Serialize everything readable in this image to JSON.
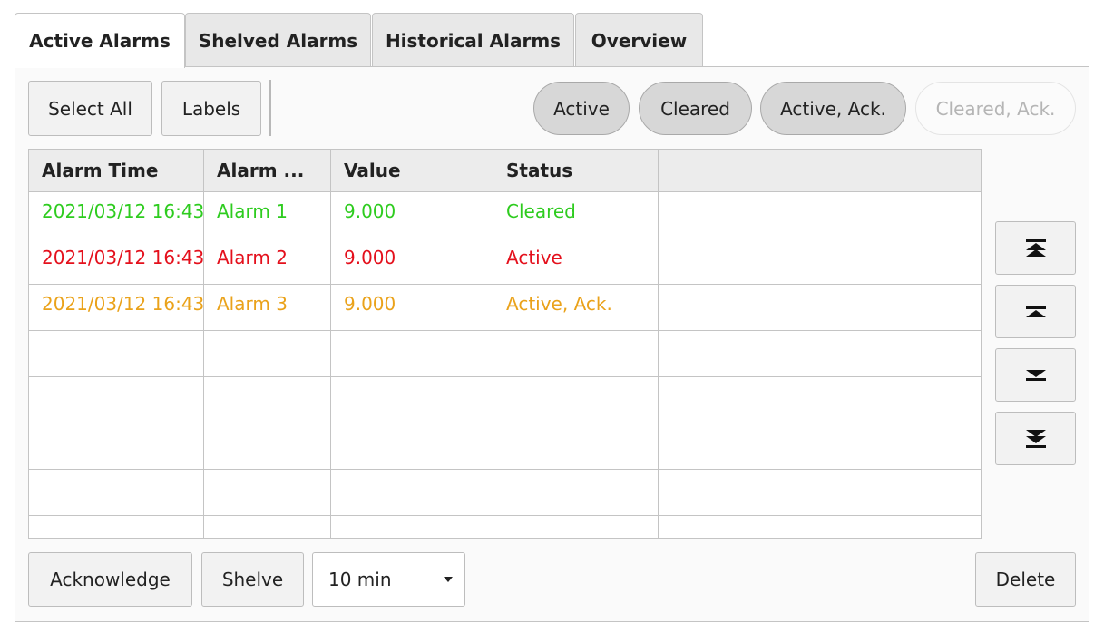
{
  "tabs": [
    {
      "label": "Active Alarms",
      "active": true
    },
    {
      "label": "Shelved Alarms",
      "active": false
    },
    {
      "label": "Historical Alarms",
      "active": false
    },
    {
      "label": "Overview",
      "active": false
    }
  ],
  "toolbar": {
    "select_all": "Select All",
    "labels": "Labels"
  },
  "filters": [
    {
      "label": "Active",
      "enabled": true
    },
    {
      "label": "Cleared",
      "enabled": true
    },
    {
      "label": "Active, Ack.",
      "enabled": true
    },
    {
      "label": "Cleared, Ack.",
      "enabled": false
    }
  ],
  "table": {
    "columns": [
      "Alarm Time",
      "Alarm ...",
      "Value",
      "Status",
      ""
    ],
    "rows": [
      {
        "time": "2021/03/12 16:43",
        "name": "Alarm 1",
        "value": "9.000",
        "status": "Cleared",
        "color": "#2ecc1f"
      },
      {
        "time": "2021/03/12 16:43",
        "name": "Alarm 2",
        "value": "9.000",
        "status": "Active",
        "color": "#e4101c"
      },
      {
        "time": "2021/03/12 16:43",
        "name": "Alarm 3",
        "value": "9.000",
        "status": "Active, Ack.",
        "color": "#eaa21a"
      }
    ]
  },
  "nav_icons": [
    "scroll-to-top-icon",
    "page-up-icon",
    "page-down-icon",
    "scroll-to-bottom-icon"
  ],
  "footer": {
    "acknowledge": "Acknowledge",
    "shelve": "Shelve",
    "duration": "10 min",
    "delete": "Delete"
  },
  "colors": {
    "cleared": "#2ecc1f",
    "active": "#e4101c",
    "acknowledged": "#eaa21a"
  }
}
